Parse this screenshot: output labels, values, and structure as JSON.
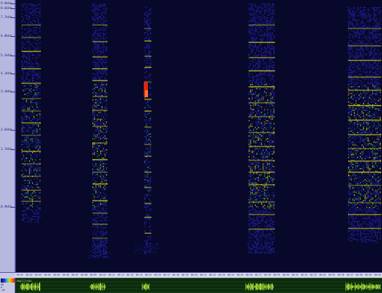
{
  "frequency_ruler": {
    "ticks": [
      "9.0kHz",
      "8.6kHz",
      "7.7kHz",
      "6.0kHz",
      "5.1kHz",
      "4.3kHz",
      "3.4kHz",
      "2.6kHz",
      "1.7kHz",
      "0.9kHz"
    ]
  },
  "time_ruler": {
    "ticks": [
      "00:01",
      "00:02",
      "00:03",
      "00:04",
      "00:05",
      "00:06",
      "00:07",
      "00:08",
      "00:09",
      "00:10",
      "00:11",
      "00:12",
      "00:13",
      "00:14",
      "00:15",
      "00:16",
      "00:17",
      "00:18",
      "00:19",
      "00:20",
      "00:21",
      "00:22",
      "00:23",
      "00:24",
      "00:25",
      "00:26",
      "00:27",
      "00:28",
      "00:29",
      "00:30",
      "00:31",
      "00:32",
      "00:33",
      "00:34",
      "00:35",
      "00:36",
      "00:37",
      "00:38",
      "00:39",
      "00:40"
    ]
  },
  "amplitude_panel": {
    "label": "Amplitude",
    "scale": [
      "dB",
      "0",
      "-60"
    ]
  },
  "colors": {
    "background": "#08082a",
    "low": "#2a2ad0",
    "mid": "#30c060",
    "high": "#e0e000",
    "peak": "#ff3000",
    "amplitude_trace": "#c8ff40"
  }
}
